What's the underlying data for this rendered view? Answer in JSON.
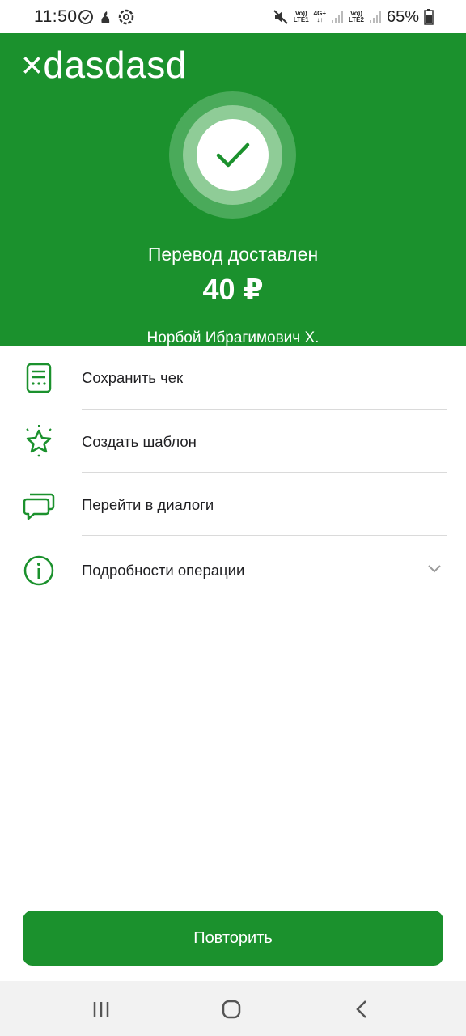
{
  "status_bar": {
    "time": "11:50",
    "sim1_top": "Vo))",
    "sim1_bottom": "LTE1",
    "net_type": "4G+",
    "sim2_top": "Vo))",
    "sim2_bottom": "LTE2",
    "battery": "65%"
  },
  "overlay_text": "×dasdasd",
  "header": {
    "status_title": "Перевод доставлен",
    "amount": "40 ₽",
    "recipient": "Норбой Ибрагимович Х."
  },
  "actions": [
    {
      "label": "Сохранить чек",
      "icon": "receipt-icon"
    },
    {
      "label": "Создать шаблон",
      "icon": "star-icon"
    },
    {
      "label": "Перейти в диалоги",
      "icon": "chat-bubbles-icon"
    },
    {
      "label": "Подробности операции",
      "icon": "info-icon"
    }
  ],
  "repeat_button": "Повторить",
  "colors": {
    "brand_green": "#1b912d",
    "divider": "#dadada"
  }
}
